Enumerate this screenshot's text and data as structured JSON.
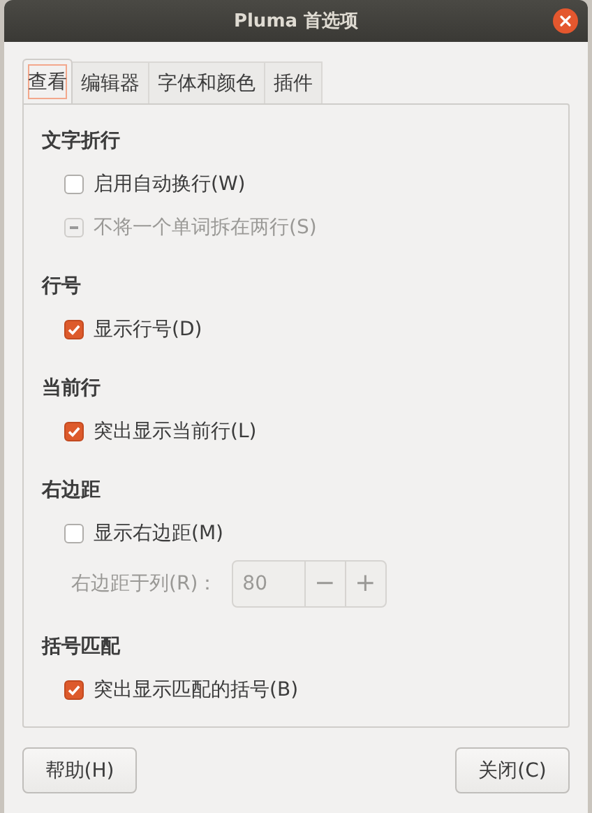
{
  "window": {
    "title": "Pluma 首选项"
  },
  "tabs": [
    {
      "label": "查看",
      "selected": true
    },
    {
      "label": "编辑器",
      "selected": false
    },
    {
      "label": "字体和颜色",
      "selected": false
    },
    {
      "label": "插件",
      "selected": false
    }
  ],
  "sections": [
    {
      "heading": "文字折行",
      "items": [
        {
          "kind": "checkbox",
          "label": "启用自动换行(W)",
          "checked": false
        },
        {
          "kind": "mixed-checkbox",
          "label": "不将一个单词拆在两行(S)",
          "disabled": true
        }
      ]
    },
    {
      "heading": "行号",
      "items": [
        {
          "kind": "checkbox",
          "label": "显示行号(D)",
          "checked": true
        }
      ]
    },
    {
      "heading": "当前行",
      "items": [
        {
          "kind": "checkbox",
          "label": "突出显示当前行(L)",
          "checked": true
        }
      ]
    },
    {
      "heading": "右边距",
      "items": [
        {
          "kind": "checkbox",
          "label": "显示右边距(M)",
          "checked": false
        },
        {
          "kind": "spin",
          "label": "右边距于列(R)：",
          "value": "80",
          "minus": "−",
          "plus": "+",
          "disabled": true
        }
      ]
    },
    {
      "heading": "括号匹配",
      "items": [
        {
          "kind": "checkbox",
          "label": "突出显示匹配的括号(B)",
          "checked": true
        }
      ]
    }
  ],
  "buttons": [
    "帮助(H)",
    "关闭(C)"
  ]
}
